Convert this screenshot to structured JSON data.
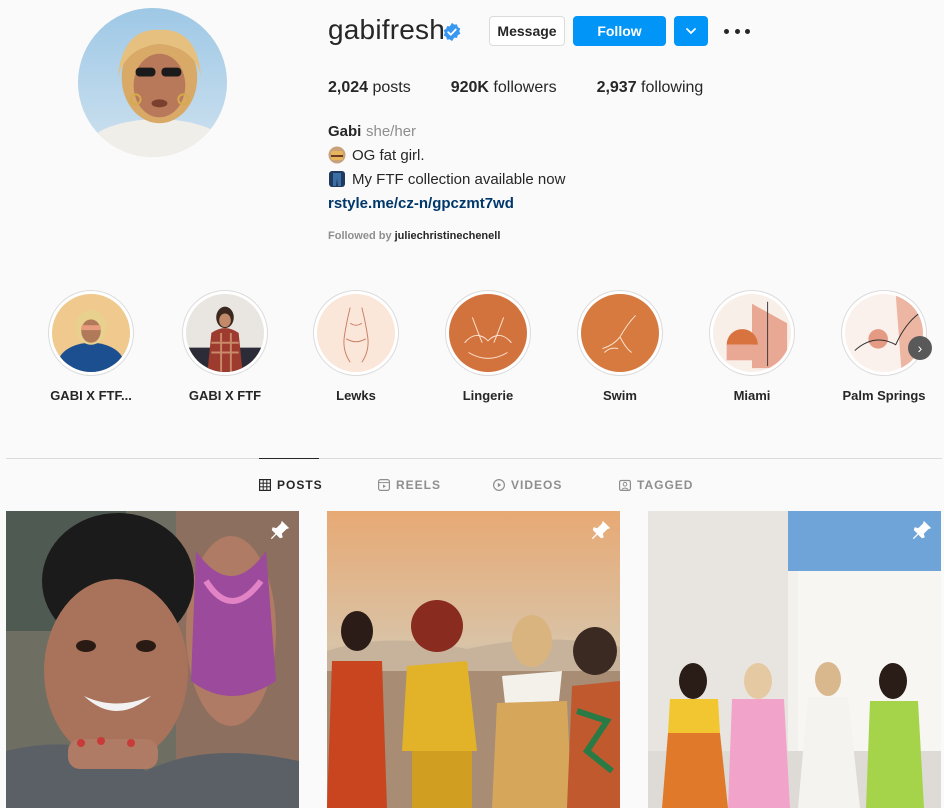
{
  "profile": {
    "username": "gabifresh",
    "message_label": "Message",
    "follow_label": "Follow",
    "dropdown_icon": "chevron-down-icon",
    "more_icon": "more-dots-icon"
  },
  "stats": {
    "posts_count": "2,024",
    "posts_label": " posts",
    "followers_count": "920K",
    "followers_label": " followers",
    "following_count": "2,937",
    "following_label": " following"
  },
  "bio": {
    "name": "Gabi",
    "pronouns": "she/her",
    "line1": "OG fat girl.",
    "line2": "My FTF collection available now",
    "link": "rstyle.me/cz-n/gpczmt7wd",
    "followed_prefix": "Followed by ",
    "followed_by": "juliechristinechenell"
  },
  "highlights": [
    {
      "label": "GABI X FTF..."
    },
    {
      "label": "GABI X FTF"
    },
    {
      "label": "Lewks"
    },
    {
      "label": "Lingerie"
    },
    {
      "label": "Swim"
    },
    {
      "label": "Miami"
    },
    {
      "label": "Palm Springs"
    }
  ],
  "tabs": [
    {
      "label": "POSTS",
      "icon": "grid-icon"
    },
    {
      "label": "REELS",
      "icon": "reels-icon"
    },
    {
      "label": "VIDEOS",
      "icon": "play-icon"
    },
    {
      "label": "TAGGED",
      "icon": "tag-icon"
    }
  ],
  "colors": {
    "accent": "#0095f6",
    "link": "#00376b",
    "muted": "#8e8e8e"
  }
}
